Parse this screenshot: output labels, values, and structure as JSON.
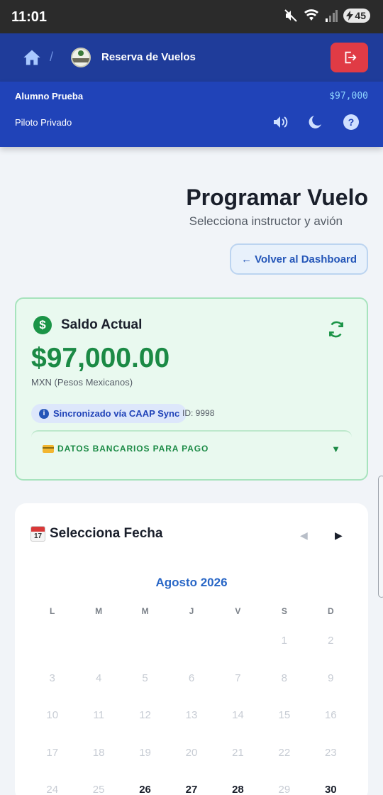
{
  "status_bar": {
    "time": "11:01",
    "battery": "45"
  },
  "nav": {
    "title": "Reserva de Vuelos",
    "separator": "/"
  },
  "user": {
    "name": "Alumno Prueba",
    "balance": "$97,000",
    "rank": "Piloto Privado"
  },
  "page": {
    "title": "Programar Vuelo",
    "subtitle": "Selecciona instructor y avión",
    "back_label": "← Volver al Dashboard"
  },
  "balance_card": {
    "title": "Saldo Actual",
    "amount": "$97,000.00",
    "currency": "MXN (Pesos Mexicanos)",
    "sync_label": "Sincronizado vía CAAP Sync",
    "sync_id": "ID: 9998",
    "bank_label": "DATOS BANCARIOS PARA PAGO",
    "dollar_symbol": "$",
    "info_symbol": "i",
    "caret": "▼"
  },
  "calendar": {
    "section_title": "Selecciona Fecha",
    "calendar_icon_number": "17",
    "prev_symbol": "◀",
    "next_symbol": "▶",
    "month": "Agosto 2026",
    "weekdays": [
      "L",
      "M",
      "M",
      "J",
      "V",
      "S",
      "D"
    ],
    "days": [
      {
        "label": "",
        "active": false
      },
      {
        "label": "",
        "active": false
      },
      {
        "label": "",
        "active": false
      },
      {
        "label": "",
        "active": false
      },
      {
        "label": "",
        "active": false
      },
      {
        "label": "1",
        "active": false
      },
      {
        "label": "2",
        "active": false
      },
      {
        "label": "3",
        "active": false
      },
      {
        "label": "4",
        "active": false
      },
      {
        "label": "5",
        "active": false
      },
      {
        "label": "6",
        "active": false
      },
      {
        "label": "7",
        "active": false
      },
      {
        "label": "8",
        "active": false
      },
      {
        "label": "9",
        "active": false
      },
      {
        "label": "10",
        "active": false
      },
      {
        "label": "11",
        "active": false
      },
      {
        "label": "12",
        "active": false
      },
      {
        "label": "13",
        "active": false
      },
      {
        "label": "14",
        "active": false
      },
      {
        "label": "15",
        "active": false
      },
      {
        "label": "16",
        "active": false
      },
      {
        "label": "17",
        "active": false
      },
      {
        "label": "18",
        "active": false
      },
      {
        "label": "19",
        "active": false
      },
      {
        "label": "20",
        "active": false
      },
      {
        "label": "21",
        "active": false
      },
      {
        "label": "22",
        "active": false
      },
      {
        "label": "23",
        "active": false
      },
      {
        "label": "24",
        "active": false
      },
      {
        "label": "25",
        "active": false
      },
      {
        "label": "26",
        "active": true
      },
      {
        "label": "27",
        "active": true
      },
      {
        "label": "28",
        "active": true
      },
      {
        "label": "29",
        "active": false
      },
      {
        "label": "30",
        "active": true
      }
    ]
  },
  "colors": {
    "nav_bg": "#1f3c9a",
    "user_bar_bg": "#2043b8",
    "logout_red": "#e03b45",
    "money_green": "#1b8a45",
    "link_blue": "#2866c6"
  },
  "icons": [
    "home-icon",
    "logo-icon",
    "logout-icon",
    "speaker-icon",
    "moon-icon",
    "help-icon",
    "dollar-icon",
    "refresh-icon",
    "info-icon",
    "credit-card-icon",
    "calendar-icon"
  ]
}
